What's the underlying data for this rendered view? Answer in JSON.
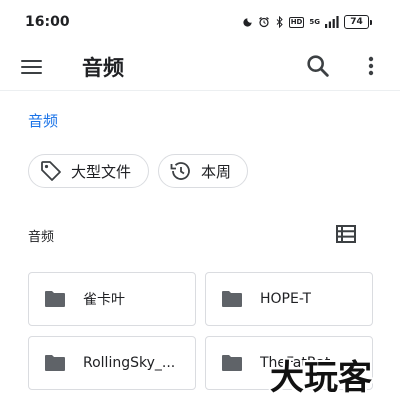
{
  "status_bar": {
    "time": "16:00",
    "network": "5G",
    "hd": "HD",
    "battery": "74"
  },
  "app_bar": {
    "title": "音频",
    "menu_icon": "hamburger-menu-icon",
    "search_icon": "search-icon",
    "more_icon": "more-vert-icon"
  },
  "breadcrumb": "音频",
  "chips": [
    {
      "label": "大型文件",
      "icon": "tag-icon"
    },
    {
      "label": "本周",
      "icon": "history-icon"
    }
  ],
  "section": {
    "title": "音频",
    "view_icon": "list-view-icon"
  },
  "folders": [
    {
      "name": "雀卡叶"
    },
    {
      "name": "HOPE-T"
    },
    {
      "name": "RollingSky_..."
    },
    {
      "name": "TheFatRat"
    }
  ],
  "watermark": "大玩客",
  "colors": {
    "accent": "#1a73e8",
    "icon": "#5f6368",
    "border": "#dadce0"
  }
}
